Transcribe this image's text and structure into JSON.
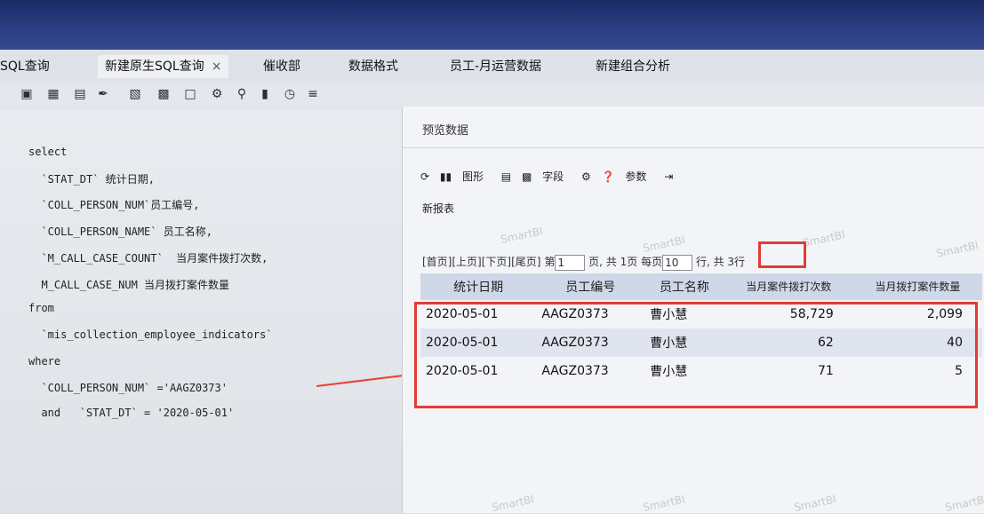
{
  "tabs": [
    {
      "label": "SQL查询"
    },
    {
      "label": "新建原生SQL查询",
      "close": "×"
    },
    {
      "label": "催收部"
    },
    {
      "label": "数据格式"
    },
    {
      "label": "员工-月运营数据"
    },
    {
      "label": "新建组合分析"
    }
  ],
  "toolbar_icons": [
    "save-icon",
    "save-as-icon",
    "window-icon",
    "brush-icon",
    "table-icon",
    "form-icon",
    "export-icon",
    "gear-icon",
    "search-icon",
    "sql-icon",
    "clock-icon",
    "format-icon"
  ],
  "sql_lines": [
    "select",
    "  `STAT_DT` 统计日期,",
    "  `COLL_PERSON_NUM`员工编号,",
    "  `COLL_PERSON_NAME` 员工名称,",
    "  `M_CALL_CASE_COUNT`  当月案件拨打次数,",
    "  M_CALL_CASE_NUM 当月拨打案件数量",
    "from",
    "  `mis_collection_employee_indicators`",
    "where",
    "  `COLL_PERSON_NUM` ='AAGZ0373'",
    "  and   `STAT_DT` = '2020-05-01'"
  ],
  "dialog": {
    "title": "预览数据",
    "toolbar": {
      "chart": "图形",
      "fields": "字段",
      "params": "参数"
    },
    "report_name": "新报表",
    "pager": {
      "first": "[首页]",
      "prev": "[上页]",
      "next": "[下页]",
      "last": "[尾页]",
      "page_prefix": "第",
      "page_value": "1",
      "page_suffix": "页,",
      "total_pages": "共 1页",
      "per_page_prefix": "每页",
      "per_page_value": "10",
      "per_page_suffix": "行,",
      "total_rows": "共 3行"
    },
    "columns": [
      "统计日期",
      "员工编号",
      "员工名称",
      "当月案件拨打次数",
      "当月拨打案件数量"
    ],
    "rows": [
      [
        "2020-05-01",
        "AAGZ0373",
        "曹小慧",
        "58,729",
        "2,099"
      ],
      [
        "2020-05-01",
        "AAGZ0373",
        "曹小慧",
        "62",
        "40"
      ],
      [
        "2020-05-01",
        "AAGZ0373",
        "曹小慧",
        "71",
        "5"
      ]
    ]
  },
  "watermark": "SmartBI",
  "colors": {
    "highlight": "#e23b36",
    "header_bg": "#cfd8e8",
    "topbar": "#1b2a63"
  }
}
